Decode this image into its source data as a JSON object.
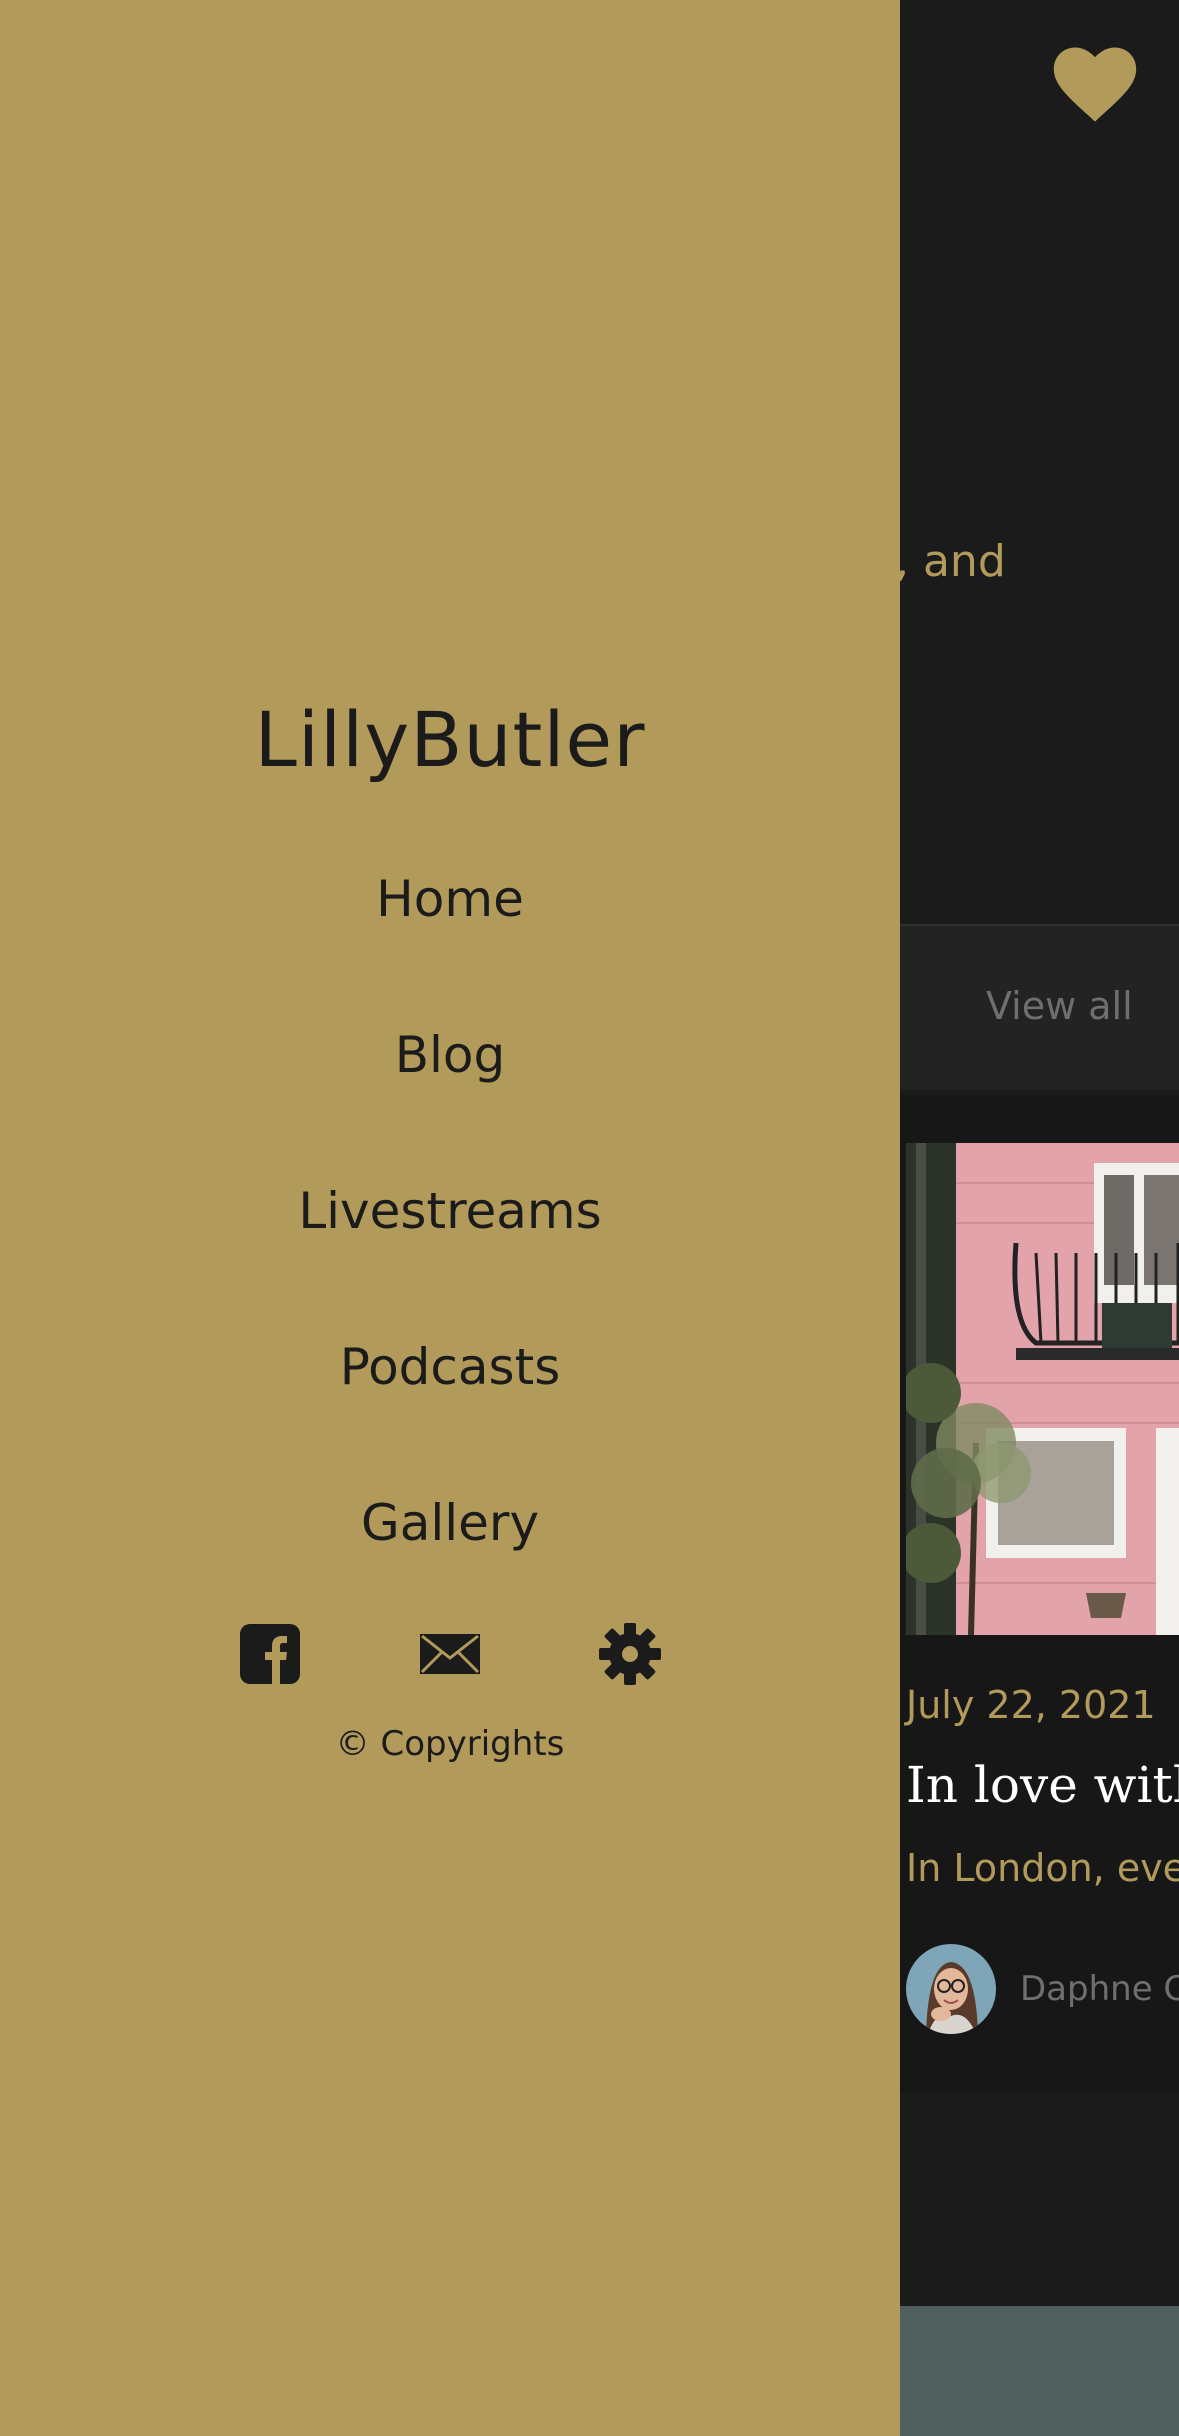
{
  "app": {
    "hero_text": ", and",
    "view_all": "View all",
    "card": {
      "date": "July 22, 2021",
      "title": "In love with",
      "excerpt": "In London, eve",
      "author": "Daphne C"
    }
  },
  "drawer": {
    "brand": "LillyButler",
    "nav": [
      {
        "label": "Home"
      },
      {
        "label": "Blog"
      },
      {
        "label": "Livestreams"
      },
      {
        "label": "Podcasts"
      },
      {
        "label": "Gallery"
      }
    ],
    "social_icons": [
      "facebook-icon",
      "mail-icon",
      "gear-icon"
    ],
    "copyright": "© Copyrights"
  },
  "colors": {
    "drawer_bg": "#b29a5b",
    "app_bg": "#1b1b1b",
    "accent": "#b29a5b",
    "text_dark": "#1b1b1b"
  }
}
